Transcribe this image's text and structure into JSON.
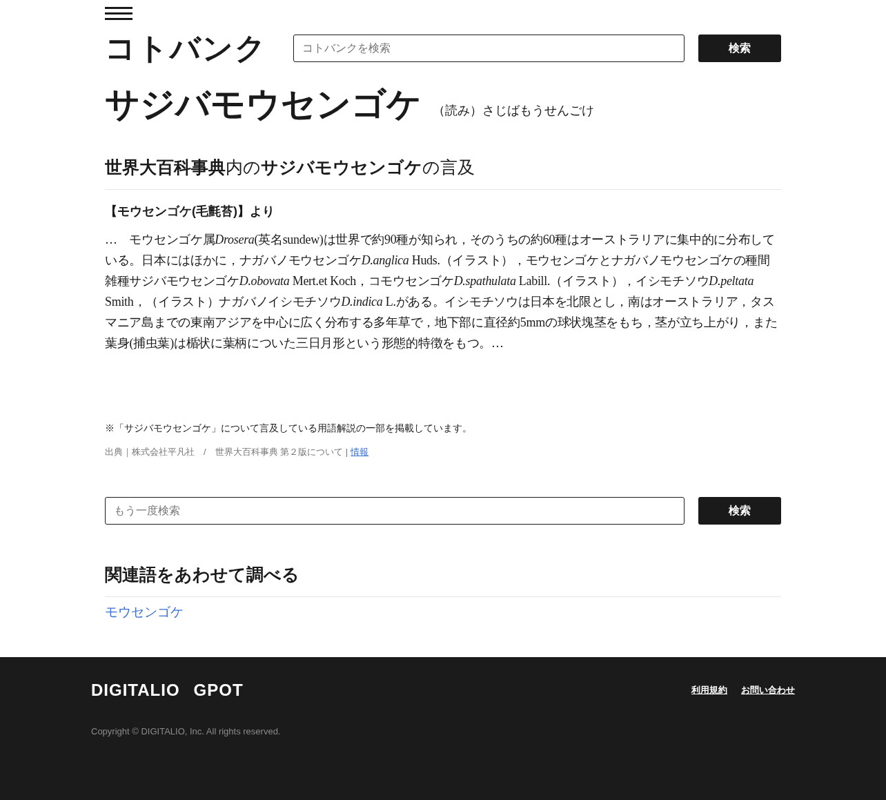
{
  "header": {
    "logo": "コトバンク",
    "search": {
      "placeholder": "コトバンクを検索",
      "button": "検索"
    }
  },
  "entry": {
    "title": "サジバモウセンゴケ",
    "reading": "（読み）さじばもうせんごけ"
  },
  "mention": {
    "heading": "**世界大百科事典**内の**サジバモウセンゴケ**の言及",
    "source_title": "【モウセンゴケ(毛氈苔)】より",
    "text": [
      {
        "text": "…　モウセンゴケ属",
        "italic": false
      },
      {
        "text": "Drosera",
        "italic": true
      },
      {
        "text": "(英名sundew)は世界で約90種が知られ，そのうちの約60種はオーストラリアに集中的に分布している。日本にはほかに，ナガバノモウセンゴケ",
        "italic": false
      },
      {
        "text": "D.anglica",
        "italic": true
      },
      {
        "text": " Huds.（イラスト），モウセンゴケとナガバノモウセンゴケの種間雑種サジバモウセンゴケ",
        "italic": false
      },
      {
        "text": "D.obovata",
        "italic": true
      },
      {
        "text": " Mert.et Koch，コモウセンゴケ",
        "italic": false
      },
      {
        "text": "D.spathulata",
        "italic": true
      },
      {
        "text": " Labill.（イラスト），イシモチソウ",
        "italic": false
      },
      {
        "text": "D.peltata",
        "italic": true
      },
      {
        "text": " Smith，（イラスト）ナガバノイシモチソウ",
        "italic": false
      },
      {
        "text": "D.indica",
        "italic": true
      },
      {
        "text": " L.がある。イシモチソウは日本を北限とし，南はオーストラリア，タスマニア島までの東南アジアを中心に広く分布する多年草で，地下部に直径約5mmの球状塊茎をもち，茎が立ち上がり，また葉身(捕虫葉)は楯状に葉柄についた三日月形という形態的特徴をもつ。…",
        "italic": false
      }
    ],
    "note": "※「サジバモウセンゴケ」について言及している用語解説の一部を掲載しています。",
    "credit": "出典｜株式会社平凡社　/　世界大百科事典 第２版について |",
    "credit_link": "情報"
  },
  "search_again": {
    "placeholder": "もう一度検索",
    "button": "検索"
  },
  "related": {
    "heading": "関連語をあわせて調べる",
    "links": [
      "モウセンゴケ"
    ]
  },
  "footer": {
    "logos": [
      "DIGITALIO",
      "GPOT"
    ],
    "links": [
      "利用規約",
      "お問い合わせ"
    ],
    "copyright": "Copyright © DIGITALIO, Inc. All rights reserved."
  }
}
